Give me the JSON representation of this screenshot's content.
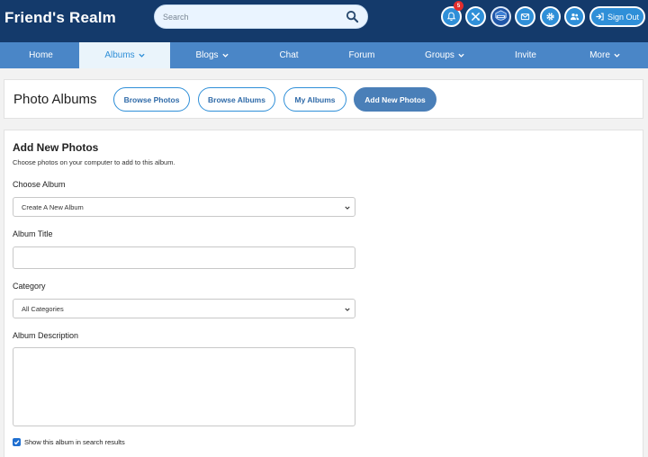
{
  "header": {
    "brand": "Friend's Realm",
    "search_placeholder": "Search",
    "notification_count": "5",
    "signout_label": "Sign Out"
  },
  "nav": {
    "items": [
      {
        "label": "Home",
        "has_dropdown": false,
        "active": false
      },
      {
        "label": "Albums",
        "has_dropdown": true,
        "active": true
      },
      {
        "label": "Blogs",
        "has_dropdown": true,
        "active": false
      },
      {
        "label": "Chat",
        "has_dropdown": false,
        "active": false
      },
      {
        "label": "Forum",
        "has_dropdown": false,
        "active": false
      },
      {
        "label": "Groups",
        "has_dropdown": true,
        "active": false
      },
      {
        "label": "Invite",
        "has_dropdown": false,
        "active": false
      },
      {
        "label": "More",
        "has_dropdown": true,
        "active": false
      }
    ]
  },
  "titlebar": {
    "title": "Photo Albums",
    "buttons": [
      "Browse Photos",
      "Browse Albums",
      "My Albums",
      "Add New Photos"
    ]
  },
  "form": {
    "title": "Add New Photos",
    "subtitle": "Choose photos on your computer to add to this album.",
    "choose_album_label": "Choose Album",
    "choose_album_value": "Create A New Album",
    "album_title_label": "Album Title",
    "album_title_value": "",
    "category_label": "Category",
    "category_value": "All Categories",
    "description_label": "Album Description",
    "description_value": "",
    "search_checkbox_label": "Show this album in search results",
    "search_checkbox_checked": true
  },
  "icons": {
    "search": "search-icon",
    "bell": "bell-icon",
    "tools": "tools-icon",
    "mail": "mail-icon",
    "gear": "gear-icon",
    "friends": "users-icon",
    "signout": "sign-out-icon"
  },
  "colors": {
    "header_bg": "#143a6b",
    "nav_bg": "#4a86c7",
    "accent": "#2f8fd8",
    "badge": "#e22d2d",
    "primary_button": "#4a7fb8"
  }
}
